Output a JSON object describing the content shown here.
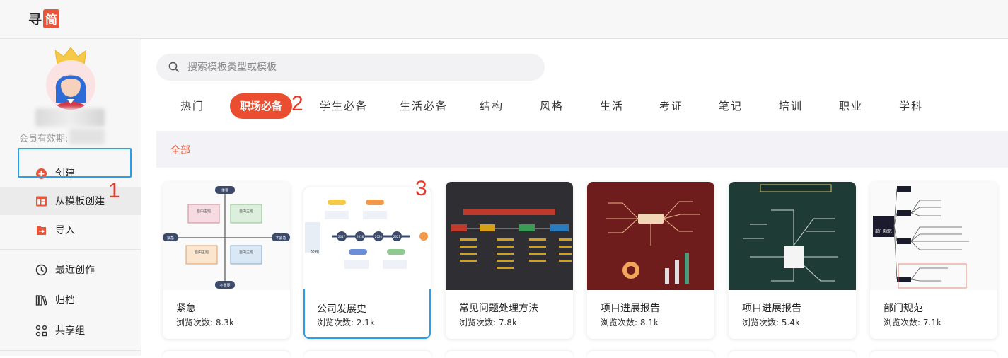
{
  "app": {
    "logo_a": "寻",
    "logo_b": "简"
  },
  "sidebar": {
    "member_label": "会员有效期:",
    "nav": [
      {
        "label": "创建",
        "icon": "plus-circle-icon"
      },
      {
        "label": "从模板创建",
        "icon": "template-icon"
      },
      {
        "label": "导入",
        "icon": "import-icon"
      },
      {
        "label": "最近创作",
        "icon": "clock-icon"
      },
      {
        "label": "归档",
        "icon": "archive-icon"
      },
      {
        "label": "共享组",
        "icon": "share-group-icon"
      }
    ]
  },
  "search": {
    "placeholder": "搜索模板类型或模板"
  },
  "tabs": [
    "热门",
    "职场必备",
    "学生必备",
    "生活必备",
    "结构",
    "风格",
    "生活",
    "考证",
    "笔记",
    "培训",
    "职业",
    "学科"
  ],
  "active_tab": "职场必备",
  "filter": {
    "all_label": "全部"
  },
  "annotations": [
    "1",
    "2",
    "3"
  ],
  "cards": [
    {
      "title": "紧急",
      "views": "浏览次数: 8.3k",
      "thumb_text": {
        "top": "重要",
        "bottom": "不重要",
        "left": "紧急",
        "right": "不紧急",
        "box": "自由主题"
      }
    },
    {
      "title": "公司发展史",
      "views": "浏览次数: 2.1k",
      "thumb_text": {
        "years": [
          "2017",
          "2018",
          "2020",
          "2021"
        ],
        "center": "公司"
      }
    },
    {
      "title": "常见问题处理方法",
      "views": "浏览次数: 7.8k"
    },
    {
      "title": "项目进展报告",
      "views": "浏览次数: 8.1k"
    },
    {
      "title": "项目进展报告",
      "views": "浏览次数: 5.4k"
    },
    {
      "title": "部门规范",
      "views": "浏览次数: 7.1k",
      "thumb_text": {
        "center": "部门规范"
      }
    }
  ],
  "colors": {
    "accent": "#ea4d2f",
    "highlight": "#2a9ee8"
  }
}
